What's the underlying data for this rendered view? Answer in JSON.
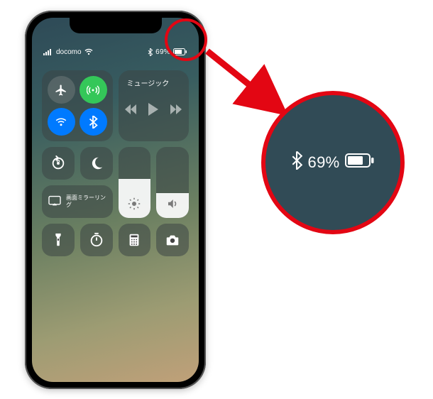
{
  "status": {
    "carrier": "docomo",
    "battery_percent": "69%"
  },
  "tiles": {
    "music_label": "ミュージック",
    "mirror_label": "画面ミラーリング"
  },
  "callout": {
    "battery_percent": "69%"
  }
}
